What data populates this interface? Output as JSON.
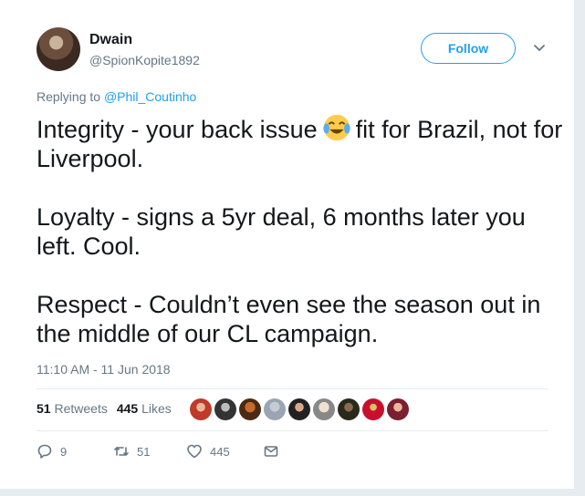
{
  "author": {
    "display_name": "Dwain",
    "handle": "@SpionKopite1892"
  },
  "follow_label": "Follow",
  "replying": {
    "prefix": "Replying to ",
    "mention": "@Phil_Coutinho"
  },
  "tweet": {
    "p1_a": "Integrity - your back issue",
    "p1_b": "fit for Brazil, not for Liverpool.",
    "p2": "Loyalty - signs a 5yr deal, 6 months later you left. Cool.",
    "p3": "Respect - Couldn’t even see the season out in the middle of our CL campaign."
  },
  "timestamp": "11:10 AM - 11 Jun 2018",
  "stats": {
    "retweets_count": "51",
    "retweets_label": "Retweets",
    "likes_count": "445",
    "likes_label": "Likes"
  },
  "actions": {
    "replies": "9",
    "retweets": "51",
    "likes": "445"
  },
  "colors": {
    "accent": "#1da1f2",
    "text": "#14171a",
    "muted": "#657786",
    "divider": "#e6ecf0"
  },
  "icons": {
    "emoji": "face-with-tears-of-joy-icon",
    "reply": "reply-icon",
    "retweet": "retweet-icon",
    "like": "heart-icon",
    "dm": "envelope-icon",
    "chevron": "chevron-down-icon"
  }
}
